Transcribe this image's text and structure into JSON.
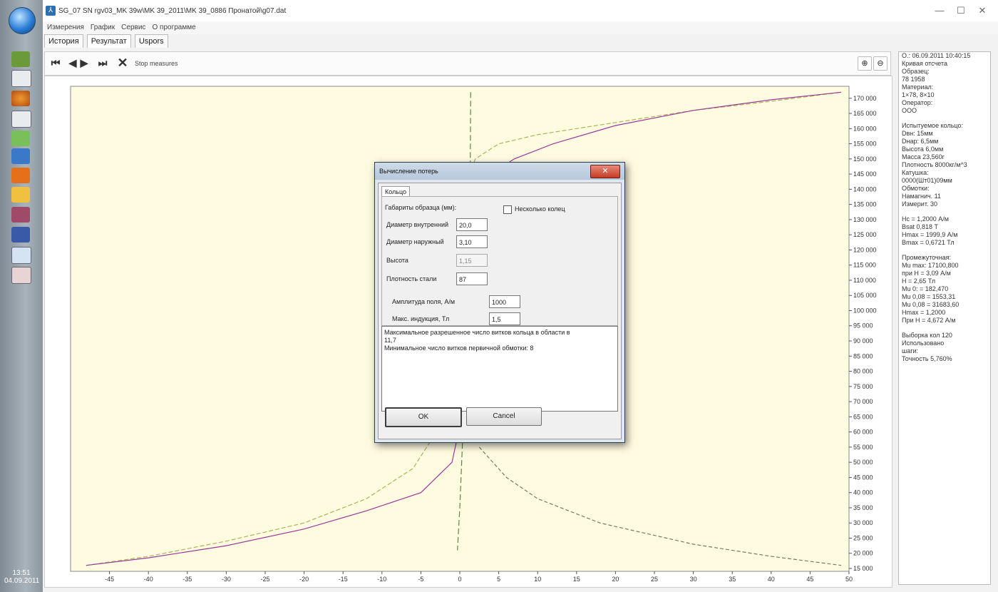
{
  "window": {
    "title": "SG_07 SN rgv03_MK 39w\\MK 39_2011\\MK 39_0886 Пронатой\\g07.dat",
    "minimize_glyph": "—",
    "maximize_glyph": "☐",
    "close_glyph": "✕"
  },
  "menu": [
    "Измерения",
    "График",
    "Сервис",
    "О программе"
  ],
  "tabs": [
    {
      "label": "История",
      "active": false
    },
    {
      "label": "Результат",
      "active": true
    },
    {
      "label": "Uspors",
      "active": false
    }
  ],
  "toolbar": {
    "first_glyph": "⏮",
    "prev_glyph": "◀",
    "next_glyph": "▶",
    "last_glyph": "⏭",
    "delete_glyph": "✕",
    "status_label": "Stop measures",
    "zoom_in_glyph": "⊕",
    "zoom_out_glyph": "⊖"
  },
  "side_panel": {
    "lines": [
      "О.: 06.09.2011 10:40:15",
      "Кривая отсчета",
      "Образец:",
      "78 1958",
      "Материал:",
      "1×78, 8×10",
      "Оператор:",
      "ООО",
      "",
      "Испытуемое кольцо:",
      "Dвн: 15мм",
      "Dнар: 6,5мм",
      "Высота 6,0мм",
      "Масса 23,560г",
      "Плотность 8000кг/м^3",
      "Катушка:",
      "0000(Шт01)09мм",
      "Обмотки:",
      "Намагнич. 11",
      "Измерит. 30",
      "",
      "Hc = 1,2000 А/м",
      "Bsat 0,818 Т",
      "Hmax = 1999,9 А/м",
      "Bmax = 0,6721 Тл",
      "",
      "Промежуточная:",
      "Mu max: 17100,800",
      "при H = 3,09 А/м",
      "H = 2,65 Тл",
      "Mu 0: = 182,470",
      "Mu 0,08 = 1553,31",
      "Mu 0,08 = 31683,60",
      "Hmax = 1,2000",
      "При H = 4,672 А/м",
      "",
      "Выборка кол 120",
      "Использовано",
      "шаги:",
      "Точность 5,760%"
    ]
  },
  "chart_data": {
    "type": "line",
    "title": "",
    "xlabel": "",
    "ylabel": "",
    "xlim": [
      -50,
      50
    ],
    "ylim": [
      15000,
      173000
    ],
    "x_ticks": [
      -45,
      -40,
      -35,
      -30,
      -25,
      -20,
      -15,
      -10,
      -5,
      0,
      5,
      10,
      15,
      20,
      25,
      30,
      35,
      40,
      45,
      50
    ],
    "y_ticks": [
      170000,
      165000,
      160000,
      155000,
      150000,
      145000,
      140000,
      135000,
      130000,
      125000,
      120000,
      115000,
      110000,
      105000,
      100000,
      95000,
      90000,
      85000,
      80000,
      75000,
      70000,
      65000,
      60000,
      55000,
      50000,
      45000,
      40000,
      35000,
      30000,
      25000,
      20000,
      15000
    ],
    "y_tick_labels": [
      "170 000",
      "165 000",
      "160 000",
      "155 000",
      "150 000",
      "145 000",
      "140 000",
      "135 000",
      "130 000",
      "125 000",
      "120 000",
      "115 000",
      "110 000",
      "105 000",
      "100 000",
      "95 000",
      "90 000",
      "85 000",
      "80 000",
      "75 000",
      "70 000",
      "65 000",
      "60 000",
      "55 000",
      "50 000",
      "45 000",
      "40 000",
      "35 000",
      "30 000",
      "25 000",
      "20 000",
      "15 000"
    ],
    "series": [
      {
        "color": "#b0b05a",
        "dash": "6,3",
        "points": [
          [
            -48,
            16000
          ],
          [
            -40,
            19000
          ],
          [
            -30,
            24000
          ],
          [
            -20,
            30000
          ],
          [
            -12,
            38000
          ],
          [
            -6,
            48000
          ],
          [
            -3,
            60000
          ],
          [
            -1.5,
            90000
          ],
          [
            -0.5,
            120000
          ],
          [
            0.5,
            140000
          ],
          [
            2,
            150000
          ],
          [
            5,
            155000
          ],
          [
            10,
            158000
          ],
          [
            20,
            162000
          ],
          [
            30,
            166000
          ],
          [
            40,
            169000
          ],
          [
            49,
            172000
          ]
        ]
      },
      {
        "color": "#9a3a9a",
        "dash": "",
        "points": [
          [
            -48,
            16000
          ],
          [
            -40,
            18500
          ],
          [
            -30,
            22500
          ],
          [
            -20,
            28000
          ],
          [
            -12,
            34000
          ],
          [
            -5,
            40000
          ],
          [
            -1,
            50000
          ],
          [
            0,
            62000
          ],
          [
            1,
            90000
          ],
          [
            2,
            125000
          ],
          [
            4,
            145000
          ],
          [
            7,
            150000
          ],
          [
            12,
            155000
          ],
          [
            20,
            161000
          ],
          [
            30,
            166000
          ],
          [
            40,
            169500
          ],
          [
            49,
            172000
          ]
        ]
      },
      {
        "color": "#5a8a3a",
        "dash": "8,4",
        "points": [
          [
            1.4,
            172000
          ],
          [
            1.3,
            130000
          ],
          [
            1.0,
            95000
          ],
          [
            0.4,
            60000
          ],
          [
            0,
            35000
          ],
          [
            -0.3,
            21000
          ]
        ]
      },
      {
        "color": "#7a7a60",
        "dash": "5,3",
        "points": [
          [
            2.5,
            55000
          ],
          [
            6,
            45000
          ],
          [
            10,
            38000
          ],
          [
            18,
            30000
          ],
          [
            30,
            23000
          ],
          [
            40,
            19000
          ],
          [
            49,
            16000
          ]
        ]
      }
    ]
  },
  "dialog": {
    "title": "Вычисление потерь",
    "close_glyph": "✕",
    "tab_label": "Кольцо",
    "section_label": "Габариты образца (мм):",
    "checkbox_label": "Несколько колец",
    "fields": [
      {
        "label": "Диаметр внутренний",
        "value": "20,0",
        "disabled": false
      },
      {
        "label": "Диаметр наружный",
        "value": "3,10",
        "disabled": false
      },
      {
        "label": "Высота",
        "value": "1,15",
        "disabled": true
      },
      {
        "label": "Плотность стали",
        "value": "87",
        "disabled": false
      }
    ],
    "field_amplitude": {
      "label": "Амплитуда поля, А/м",
      "value": "1000"
    },
    "field_induction": {
      "label": "Макс. индукция, Тл",
      "value": "1,5"
    },
    "message_lines": [
      "Максимальное разрешенное число витков кольца в области в",
      "11,7",
      "Минимальное число витков первичной обмотки: 8"
    ],
    "ok_label": "OK",
    "cancel_label": "Cancel"
  },
  "taskbar": {
    "clock": "13:51",
    "date": "04.09.2011"
  },
  "colors": {
    "plot_bg": "#fefbe0",
    "accent_dialog_close": "#c63d26"
  }
}
